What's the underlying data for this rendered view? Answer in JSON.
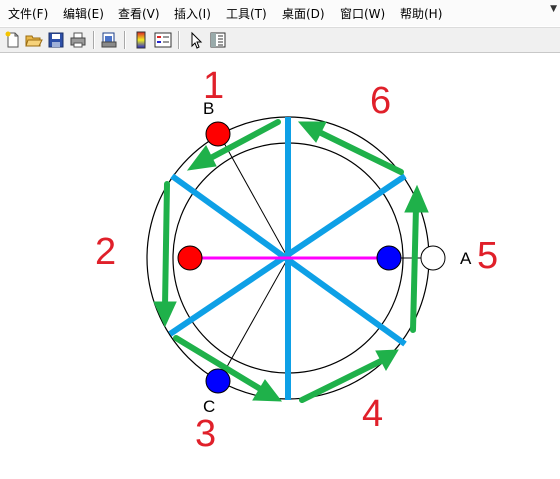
{
  "menu": {
    "items": [
      {
        "label": "文件(F)"
      },
      {
        "label": "编辑(E)"
      },
      {
        "label": "查看(V)"
      },
      {
        "label": "插入(I)"
      },
      {
        "label": "工具(T)"
      },
      {
        "label": "桌面(D)"
      },
      {
        "label": "窗口(W)"
      },
      {
        "label": "帮助(H)"
      }
    ],
    "overflow_icon": "chevron-down-icon"
  },
  "toolbar": {
    "buttons": [
      {
        "icon": "new-file-icon"
      },
      {
        "icon": "open-folder-icon"
      },
      {
        "icon": "save-icon"
      },
      {
        "icon": "print-icon"
      },
      {
        "icon": "print-preview-icon"
      },
      {
        "icon": "colorbar-icon"
      },
      {
        "icon": "legend-icon"
      },
      {
        "icon": "pointer-icon"
      },
      {
        "icon": "property-editor-icon"
      }
    ]
  },
  "diagram": {
    "step_labels": [
      "1",
      "2",
      "3",
      "4",
      "5",
      "6"
    ],
    "point_labels": {
      "a": "A",
      "b": "B",
      "c": "C"
    },
    "colors": {
      "blue_lines": "#0ea0e6",
      "arrows": "#1fb14a",
      "magenta_line": "#ff00ff",
      "red": "#ff0000",
      "blue": "#0000ff",
      "step_numbers": "#e0202a"
    }
  }
}
